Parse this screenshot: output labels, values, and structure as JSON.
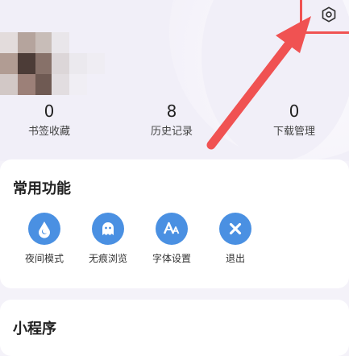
{
  "header": {
    "settings_icon": "gear-icon"
  },
  "stats": [
    {
      "value": "0",
      "label": "书签收藏"
    },
    {
      "value": "8",
      "label": "历史记录"
    },
    {
      "value": "0",
      "label": "下载管理"
    }
  ],
  "common_functions": {
    "title": "常用功能",
    "items": [
      {
        "label": "夜间模式",
        "icon": "night-mode-icon"
      },
      {
        "label": "无痕浏览",
        "icon": "incognito-ghost-icon"
      },
      {
        "label": "字体设置",
        "icon": "font-settings-icon"
      },
      {
        "label": "退出",
        "icon": "exit-icon"
      }
    ]
  },
  "mini_programs": {
    "title": "小程序"
  },
  "colors": {
    "accent_blue": "#4a90e2",
    "highlight_red": "#f05252",
    "page_bg": "#f4f2f9"
  }
}
